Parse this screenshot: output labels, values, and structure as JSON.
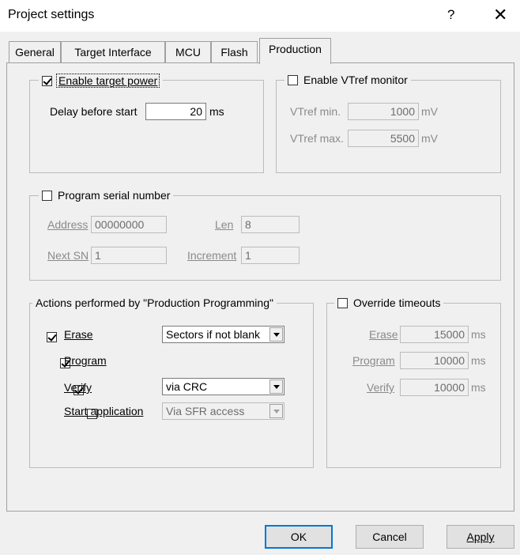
{
  "window": {
    "title": "Project settings",
    "help_label": "?",
    "close_label": "✕"
  },
  "tabs": [
    {
      "label": "General"
    },
    {
      "label": "Target Interface"
    },
    {
      "label": "MCU"
    },
    {
      "label": "Flash"
    },
    {
      "label": "Production"
    }
  ],
  "target_power": {
    "label": "Enable target power",
    "checked": true,
    "delay_label": "Delay before start",
    "delay_value": "20",
    "delay_unit": "ms"
  },
  "vtref": {
    "label": "Enable VTref monitor",
    "checked": false,
    "min_label": "VTref min.",
    "min_value": "1000",
    "min_unit": "mV",
    "max_label": "VTref max.",
    "max_value": "5500",
    "max_unit": "mV"
  },
  "serial": {
    "label": "Program serial number",
    "checked": false,
    "address_label": "Address",
    "address_value": "00000000",
    "len_label": "Len",
    "len_value": "8",
    "next_label": "Next SN",
    "next_value": "1",
    "increment_label": "Increment",
    "increment_value": "1"
  },
  "actions": {
    "label": "Actions performed by \"Production Programming\"",
    "erase": {
      "label": "Erase",
      "checked": true,
      "option": "Sectors if not blank"
    },
    "program": {
      "label": "Program",
      "checked": true
    },
    "verify": {
      "label": "Verify",
      "checked": true,
      "option": "via CRC"
    },
    "start": {
      "label": "Start application",
      "checked": false,
      "option": "Via SFR access"
    }
  },
  "timeouts": {
    "label": "Override timeouts",
    "checked": false,
    "erase_label": "Erase",
    "erase_value": "15000",
    "program_label": "Program",
    "program_value": "10000",
    "verify_label": "Verify",
    "verify_value": "10000",
    "unit": "ms"
  },
  "buttons": {
    "ok": "OK",
    "cancel": "Cancel",
    "apply": "Apply"
  }
}
